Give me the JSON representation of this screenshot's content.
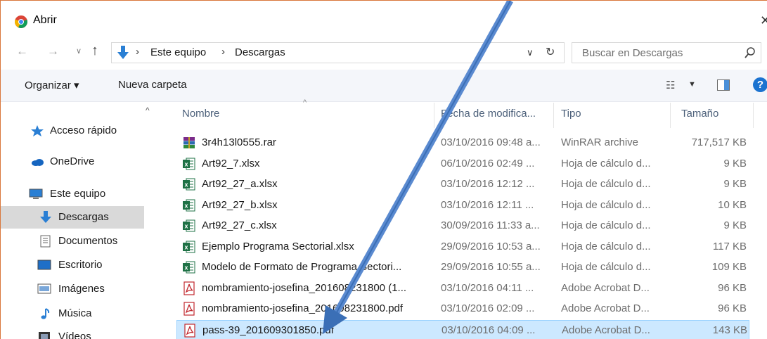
{
  "window": {
    "title": "Abrir",
    "close": "✕"
  },
  "address": {
    "crumbs": [
      "Este equipo",
      "Descargas"
    ],
    "separator": "›",
    "search_placeholder": "Buscar en Descargas"
  },
  "commands": {
    "organize": "Organizar ▾",
    "new_folder": "Nueva carpeta"
  },
  "nav": {
    "items": [
      {
        "label": "Acceso rápido",
        "icon": "star-icon"
      },
      {
        "label": "OneDrive",
        "icon": "cloud-icon"
      },
      {
        "label": "Este equipo",
        "icon": "computer-icon"
      },
      {
        "label": "Descargas",
        "icon": "download-icon",
        "selected": true
      },
      {
        "label": "Documentos",
        "icon": "document-icon"
      },
      {
        "label": "Escritorio",
        "icon": "desktop-icon"
      },
      {
        "label": "Imágenes",
        "icon": "pictures-icon"
      },
      {
        "label": "Música",
        "icon": "music-icon"
      },
      {
        "label": "Vídeos",
        "icon": "video-icon"
      }
    ]
  },
  "columns": {
    "name": "Nombre",
    "date": "Fecha de modifica...",
    "type": "Tipo",
    "size": "Tamaño"
  },
  "files": [
    {
      "name": "3r4h13l0555.rar",
      "date": "03/10/2016 09:48 a...",
      "type": "WinRAR archive",
      "size": "717,517 KB",
      "icon": "rar-icon"
    },
    {
      "name": "Art92_7.xlsx",
      "date": "06/10/2016 02:49 ...",
      "type": "Hoja de cálculo d...",
      "size": "9 KB",
      "icon": "excel-icon"
    },
    {
      "name": "Art92_27_a.xlsx",
      "date": "03/10/2016 12:12 ...",
      "type": "Hoja de cálculo d...",
      "size": "9 KB",
      "icon": "excel-icon"
    },
    {
      "name": "Art92_27_b.xlsx",
      "date": "03/10/2016 12:11 ...",
      "type": "Hoja de cálculo d...",
      "size": "10 KB",
      "icon": "excel-icon"
    },
    {
      "name": "Art92_27_c.xlsx",
      "date": "30/09/2016 11:33 a...",
      "type": "Hoja de cálculo d...",
      "size": "9 KB",
      "icon": "excel-icon"
    },
    {
      "name": "Ejemplo Programa Sectorial.xlsx",
      "date": "29/09/2016 10:53 a...",
      "type": "Hoja de cálculo d...",
      "size": "117 KB",
      "icon": "excel-icon"
    },
    {
      "name": "Modelo de Formato de Programa Sectori...",
      "date": "29/09/2016 10:55 a...",
      "type": "Hoja de cálculo d...",
      "size": "109 KB",
      "icon": "excel-icon"
    },
    {
      "name": "nombramiento-josefina_201608231800 (1...",
      "date": "03/10/2016 04:11 ...",
      "type": "Adobe Acrobat D...",
      "size": "96 KB",
      "icon": "pdf-icon"
    },
    {
      "name": "nombramiento-josefina_201608231800.pdf",
      "date": "03/10/2016 02:09 ...",
      "type": "Adobe Acrobat D...",
      "size": "96 KB",
      "icon": "pdf-icon"
    },
    {
      "name": "pass-39_201609301850.pdf",
      "date": "03/10/2016 04:09 ...",
      "type": "Adobe Acrobat D...",
      "size": "143 KB",
      "icon": "pdf-icon",
      "selected": true
    }
  ],
  "colors": {
    "accent": "#1b73d0",
    "selection": "#cce8ff",
    "arrow": "#4a7bc0"
  }
}
